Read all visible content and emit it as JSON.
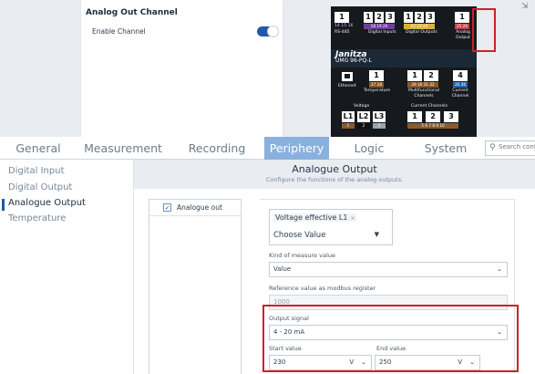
{
  "channel_card": {
    "title": "Analog Out Channel",
    "enable_label": "Enable Channel",
    "enabled": true
  },
  "device": {
    "rs485": {
      "num": "1",
      "pins": "14 15 16",
      "label": "RS-485"
    },
    "digital_inputs": {
      "nums": [
        "1",
        "2",
        "3"
      ],
      "pins": "18 19 20",
      "label": "Digital Inputs"
    },
    "digital_outputs": {
      "nums": [
        "1",
        "2",
        "3"
      ],
      "pins": "22 23 24",
      "label": "Digital Outputs"
    },
    "analog_output": {
      "num": "1",
      "pins": "25 26",
      "label": "Analog Output"
    },
    "brand": "Janitza",
    "model": "UMG 96-PQ-L",
    "ethernet_label": "Ethernet",
    "temperature": {
      "num": "1",
      "pins": "27 28",
      "label": "Temperature"
    },
    "multifunctional": {
      "nums": [
        "1",
        "2"
      ],
      "pins": "29 30 31 32",
      "label": "Multifunctional Channels"
    },
    "current_channel": {
      "num": "4",
      "pins": "35 36",
      "label": "Current Channel"
    },
    "voltage": {
      "label": "Voltage",
      "nums": [
        "L1",
        "L2",
        "L3"
      ],
      "pins": [
        "1",
        "2",
        "3"
      ]
    },
    "current_channels": {
      "label": "Current Channels",
      "nums": [
        "1",
        "2",
        "3"
      ],
      "pins": "5 6 7 8 9 10"
    }
  },
  "tabs": [
    {
      "label": "General",
      "active": false
    },
    {
      "label": "Measurement",
      "active": false
    },
    {
      "label": "Recording",
      "active": false
    },
    {
      "label": "Periphery",
      "active": true
    },
    {
      "label": "Logic",
      "active": false
    },
    {
      "label": "System",
      "active": false
    }
  ],
  "search": {
    "placeholder": "Search conf"
  },
  "sidebar": {
    "items": [
      {
        "label": "Digital Input",
        "active": false
      },
      {
        "label": "Digital Output",
        "active": false
      },
      {
        "label": "Analogue Output",
        "active": true
      },
      {
        "label": "Temperature",
        "active": false
      }
    ]
  },
  "main": {
    "title": "Analogue Output",
    "subtitle": "Configure the functions of the analog outputs."
  },
  "list": {
    "item_label": "Analogue out",
    "checked": true
  },
  "form": {
    "value_chip": "Voltage effective L1",
    "chip_remove": "×",
    "value_placeholder": "Choose Value",
    "kind_label": "Kind of measure value",
    "kind_value": "Value",
    "ref_label": "Reference value as modbus register",
    "ref_value": "1000",
    "output_signal_label": "Output signal",
    "output_signal_value": "4 - 20 mA",
    "start_label": "Start value",
    "start_value": "230",
    "start_unit": "V",
    "end_label": "End value",
    "end_value": "250",
    "end_unit": "V"
  },
  "colors": {
    "accent": "#1e5aa8",
    "active_tab": "#8ab0dd",
    "highlight": "#d0202a",
    "device_bg": "#16191d",
    "pin_brown": "#8a5a2b",
    "pin_purple": "#6e3f97",
    "pin_yellow": "#d8b13a",
    "pin_red": "#c9414a",
    "pin_blue": "#2b66b3"
  },
  "icons": {
    "toggle": "toggle-switch-icon",
    "search": "search-icon",
    "ethernet": "ethernet-port-icon",
    "check": "checkbox-check-icon",
    "dropdown": "chevron-down-icon",
    "chip_remove": "close-icon",
    "corner": "external-link-icon"
  }
}
